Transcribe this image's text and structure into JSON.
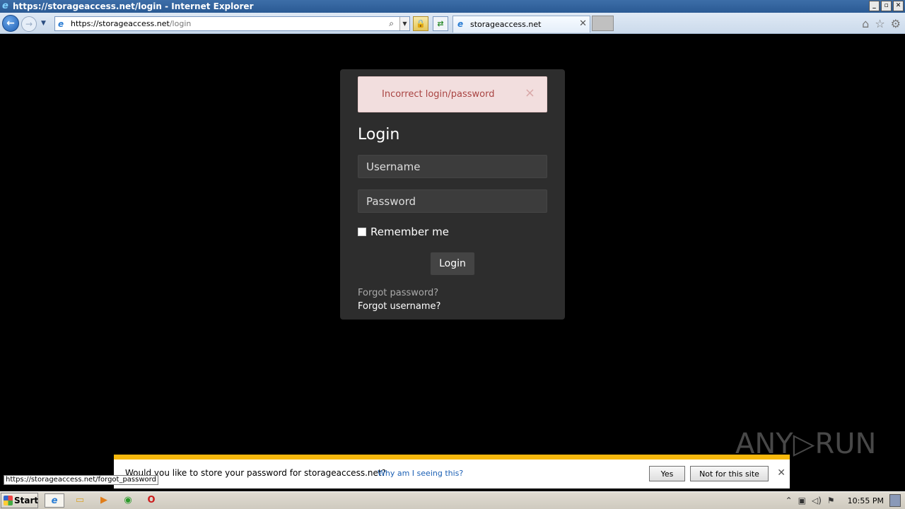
{
  "window": {
    "title": "https://storageaccess.net/login - Internet Explorer",
    "controls": [
      "_",
      "▫",
      "✕"
    ]
  },
  "browser": {
    "address_host": "https://storageaccess.net",
    "address_path": "/login",
    "tab_title": "storageaccess.net"
  },
  "login": {
    "alert_text": "Incorrect login/password",
    "alert_close": "×",
    "title": "Login",
    "username_placeholder": "Username",
    "password_placeholder": "Password",
    "remember_label": "Remember me",
    "submit_label": "Login",
    "forgot_password": "Forgot password?",
    "forgot_username": "Forgot username?"
  },
  "watermark": "ANY▷RUN",
  "notification": {
    "text": "Would you like to store your password for storageaccess.net?",
    "why_link": "Why am I seeing this?",
    "yes_label": "Yes",
    "no_label": "Not for this site",
    "close": "✕"
  },
  "status_bar": {
    "url": "https://storageaccess.net/forgot_password"
  },
  "taskbar": {
    "start_label": "Start",
    "clock": "10:55 PM"
  },
  "colors": {
    "alert_bg": "#f2dede",
    "alert_text": "#a94442",
    "card_bg": "#2d2d2d",
    "notif_accent": "#f6b80c"
  }
}
